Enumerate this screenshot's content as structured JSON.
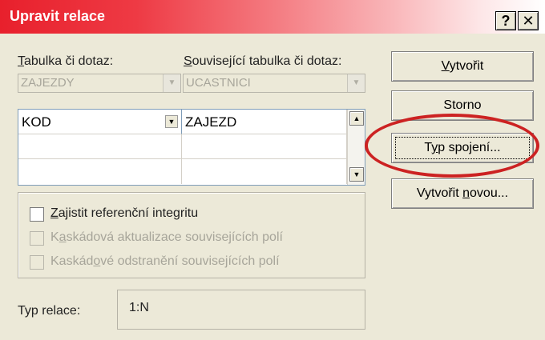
{
  "window": {
    "title": "Upravit relace",
    "help_label": "?",
    "close_label": "✕"
  },
  "left": {
    "table_label": "Tabulka či dotaz:",
    "table_label_mnemonic": "T",
    "table_label_rest": "abulka či dotaz:",
    "table_value": "ZAJEZDY"
  },
  "right": {
    "related_label_mnemonic": "S",
    "related_label_rest": "ouvisející tabulka či dotaz:",
    "related_value": "UCASTNICI"
  },
  "grid": {
    "rows": [
      {
        "left": "KOD",
        "right": "ZAJEZD"
      },
      {
        "left": "",
        "right": ""
      },
      {
        "left": "",
        "right": ""
      }
    ]
  },
  "options": {
    "ref_integrity_mnemonic": "Z",
    "ref_integrity_rest": "ajistit referenční integritu",
    "cascade_update_pre": "K",
    "cascade_update_mnemonic": "a",
    "cascade_update_rest": "skádová aktualizace souvisejících polí",
    "cascade_delete_pre": "Kaskád",
    "cascade_delete_mnemonic": "o",
    "cascade_delete_rest": "vé odstranění souvisejících polí",
    "ref_integrity_checked": false,
    "cascade_update_checked": false,
    "cascade_delete_checked": false
  },
  "relation": {
    "label": "Typ relace:",
    "value": "1:N"
  },
  "buttons": {
    "create_mnemonic": "V",
    "create_rest": "ytvořit",
    "cancel": "Storno",
    "join_type_pre": "T",
    "join_type_mnemonic": "y",
    "join_type_rest": "p spojení...",
    "create_new_pre": "Vytvořit ",
    "create_new_mnemonic": "n",
    "create_new_rest": "ovou..."
  },
  "colors": {
    "title_red": "#e8202c",
    "annotation_red": "#cc2222",
    "dialog_bg": "#ece9d8"
  }
}
